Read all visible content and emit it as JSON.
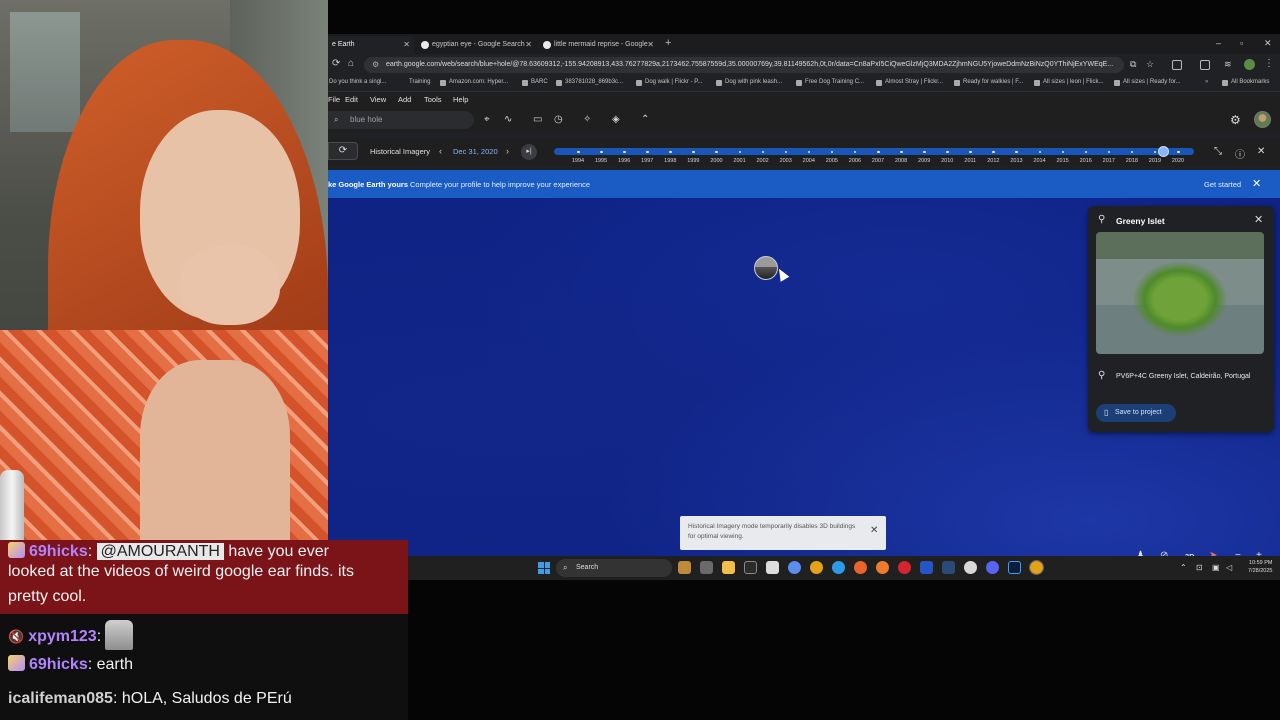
{
  "browser": {
    "tabs": [
      {
        "label": "e Earth",
        "active": true
      },
      {
        "label": "egyptian eye - Google Search",
        "active": false
      },
      {
        "label": "little mermaid reprise - Google",
        "active": false
      }
    ],
    "url": "earth.google.com/web/search/blue+hole/@78.63609312,-155.94208913,433.76277829a,2173462.75587559d,35.00000769y,39.81149562h,0t,0r/data=Cn8aPxI5CiQweGlzMjQ3MDA2ZjhmNGU5YjoweDdmNzBiNzQ0YThiNjExYWEqE...",
    "bookmarks": [
      "Do you think a singl...",
      "Training",
      "Amazon.com: Hyper...",
      "BARC",
      "383781028_869b3c...",
      "Dog walk | Flickr - P...",
      "Dog with pink leash...",
      "Free Dog Training C...",
      "Almost Stray | Flickr...",
      "Ready for walkies | F...",
      "All sizes | leon | Flick...",
      "All sizes | Ready for...",
      "All Bookmarks"
    ]
  },
  "earth": {
    "menu": [
      "File",
      "Edit",
      "View",
      "Add",
      "Tools",
      "Help"
    ],
    "search_value": "blue hole",
    "historical_label": "Historical Imagery",
    "historical_date": "Dec 31, 2020",
    "timeline_years": [
      "1994",
      "1995",
      "1996",
      "1997",
      "1998",
      "1999",
      "2000",
      "2001",
      "2002",
      "2003",
      "2004",
      "2005",
      "2006",
      "2007",
      "2008",
      "2009",
      "2010",
      "2011",
      "2012",
      "2013",
      "2014",
      "2015",
      "2016",
      "2017",
      "2018",
      "2019",
      "2020"
    ],
    "timeline_selected_fraction": 0.975,
    "banner": {
      "title": "ke Google Earth yours",
      "message": "Complete your profile to help improve your experience",
      "cta": "Get started"
    },
    "place": {
      "title": "Greeny Islet",
      "address": "PV6P+4C Greeny Islet, Caldeirão, Portugal",
      "save": "Save to project"
    },
    "toast": "Historical Imagery mode temporarily disables 3D buildings for optimal viewing.",
    "map_3d": "3D"
  },
  "taskbar": {
    "search": "Search",
    "time": "10:59 PM",
    "date": "7/28/2025"
  },
  "chat": {
    "messages": [
      {
        "user": "69hicks",
        "mention": "@AMOURANTH",
        "text1": "have you ever",
        "text2": "looked at the videos of weird google ear finds. its",
        "text3": "pretty cool."
      },
      {
        "user": "xpym123",
        "text": ":"
      },
      {
        "user": "69hicks",
        "text": ": earth"
      },
      {
        "user": "icalifeman085",
        "text": ": hOLA, Saludos de PErú"
      }
    ]
  },
  "colors": {
    "map_ocean": "#0f2385",
    "banner_blue": "#1a5bc4",
    "timeline_blue": "#1a55b8",
    "chat_highlight": "#7a1418",
    "username_purple": "#b084ff"
  }
}
